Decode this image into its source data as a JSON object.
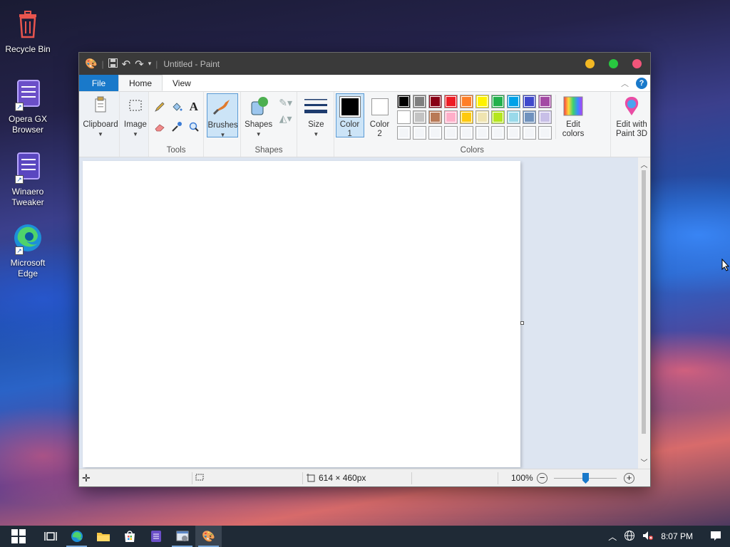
{
  "desktop": {
    "icons": [
      {
        "label": "Recycle Bin",
        "icon": "recycle-bin-icon"
      },
      {
        "label": "Opera GX Browser",
        "icon": "notepad-style-icon"
      },
      {
        "label": "Winaero Tweaker",
        "icon": "notepad-style-icon"
      },
      {
        "label": "Microsoft Edge",
        "icon": "edge-icon"
      }
    ]
  },
  "window": {
    "title": "Untitled - Paint",
    "controls": {
      "minimize_color": "#f2b823",
      "maximize_color": "#28c840",
      "close_color": "#f2557a"
    }
  },
  "tabs": {
    "file": "File",
    "home": "Home",
    "view": "View"
  },
  "ribbon": {
    "clipboard": "Clipboard",
    "image": "Image",
    "tools_label": "Tools",
    "brushes": "Brushes",
    "shapes_btn": "Shapes",
    "shapes_label": "Shapes",
    "size": "Size",
    "color1_line1": "Color",
    "color1_line2": "1",
    "color2_line1": "Color",
    "color2_line2": "2",
    "colors_label": "Colors",
    "edit_colors_line1": "Edit",
    "edit_colors_line2": "colors",
    "edit3d_line1": "Edit with",
    "edit3d_line2": "Paint 3D",
    "color1_value": "#000000",
    "color2_value": "#ffffff",
    "palette_row1": [
      "#000000",
      "#7f7f7f",
      "#880015",
      "#ed1c24",
      "#ff7f27",
      "#fff200",
      "#22b14c",
      "#00a2e8",
      "#3f48cc",
      "#a349a4"
    ],
    "palette_row2": [
      "#ffffff",
      "#c3c3c3",
      "#b97a57",
      "#ffaec9",
      "#ffc90e",
      "#efe4b0",
      "#b5e61d",
      "#99d9ea",
      "#7092be",
      "#c8bfe7"
    ],
    "palette_row3_count": 10
  },
  "status": {
    "dimensions": "614 × 460px",
    "zoom": "100%",
    "zoom_level": 0.5
  },
  "taskbar": {
    "time": "8:07 PM"
  }
}
